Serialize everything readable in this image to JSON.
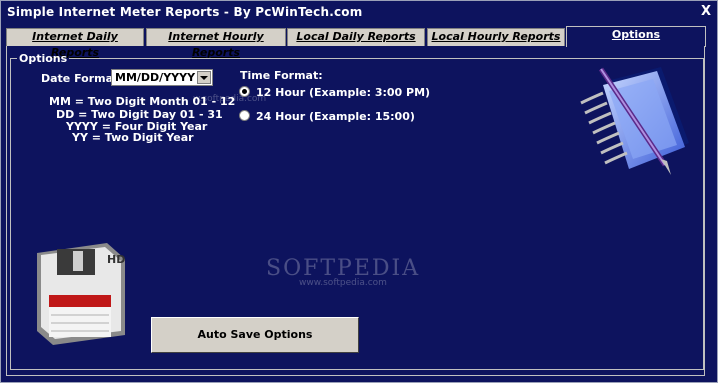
{
  "window": {
    "title": "Simple Internet Meter Reports - By PcWinTech.com",
    "close_label": "X"
  },
  "tabs": [
    {
      "label": "Internet Daily Reports",
      "active": false
    },
    {
      "label": "Internet Hourly Reports",
      "active": false
    },
    {
      "label": "Local Daily Reports",
      "active": false
    },
    {
      "label": "Local Hourly Reports",
      "active": false
    },
    {
      "label": "Options",
      "active": true
    }
  ],
  "options": {
    "group_label": "Options",
    "date_format_label": "Date Format:",
    "date_format_value": "MM/DD/YYYY",
    "date_legend": [
      "MM = Two Digit Month 01 - 12",
      "DD = Two Digit Day 01 - 31",
      "YYYY = Four Digit Year",
      "YY = Two Digit Year"
    ],
    "time_format_label": "Time Format:",
    "time_options": [
      {
        "label": "12 Hour (Example: 3:00 PM)",
        "selected": true
      },
      {
        "label": "24 Hour (Example: 15:00)",
        "selected": false
      }
    ],
    "auto_save_label": "Auto Save Options"
  },
  "icons": {
    "notebook": "notebook-pen-icon",
    "floppy": "floppy-disk-icon",
    "floppy_text": "HD"
  },
  "watermark": {
    "main": "SOFTPEDIA",
    "url": "www.softpedia.com",
    "url2": "w.softpedia.com"
  },
  "colors": {
    "background": "#0d135e",
    "tab_inactive": "#d4d0c8",
    "text": "#ffffff"
  }
}
